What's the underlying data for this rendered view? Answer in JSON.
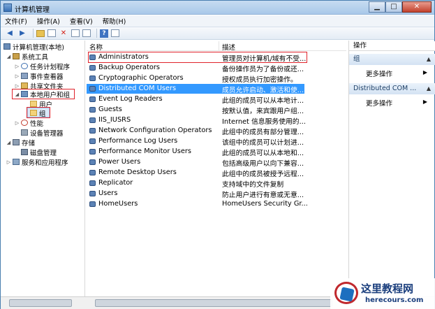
{
  "window": {
    "title": "计算机管理",
    "min_label": "▁",
    "max_label": "□",
    "close_label": "✕"
  },
  "menu": [
    "文件(F)",
    "操作(A)",
    "查看(V)",
    "帮助(H)"
  ],
  "toolbar_icons": [
    "back-arrow-icon",
    "forward-arrow-icon",
    "up-folder-icon",
    "show-tree-icon",
    "delete-icon",
    "properties-icon",
    "export-icon",
    "help-icon",
    "view-icon"
  ],
  "tree": {
    "root": "计算机管理(本地)",
    "system_tools": "系统工具",
    "task_scheduler": "任务计划程序",
    "event_viewer": "事件查看器",
    "shared_folders": "共享文件夹",
    "local_users_groups": "本地用户和组",
    "users": "用户",
    "groups": "组",
    "performance": "性能",
    "device_manager": "设备管理器",
    "storage": "存储",
    "disk_management": "磁盘管理",
    "services_apps": "服务和应用程序"
  },
  "list": {
    "col_name": "名称",
    "col_desc": "描述",
    "rows": [
      {
        "name": "Administrators",
        "desc": "管理员对计算机/域有不受..."
      },
      {
        "name": "Backup Operators",
        "desc": "备份操作员为了备份或还..."
      },
      {
        "name": "Cryptographic Operators",
        "desc": "授权成员执行加密操作。"
      },
      {
        "name": "Distributed COM Users",
        "desc": "成员允许启动、激活和使..."
      },
      {
        "name": "Event Log Readers",
        "desc": "此组的成员可以从本地计..."
      },
      {
        "name": "Guests",
        "desc": "按默认值，来宾跟用户组..."
      },
      {
        "name": "IIS_IUSRS",
        "desc": "Internet 信息服务使用的..."
      },
      {
        "name": "Network Configuration Operators",
        "desc": "此组中的成员有部分管理..."
      },
      {
        "name": "Performance Log Users",
        "desc": "该组中的成员可以计划进..."
      },
      {
        "name": "Performance Monitor Users",
        "desc": "此组的成员可以从本地和..."
      },
      {
        "name": "Power Users",
        "desc": "包括高级用户以向下兼容..."
      },
      {
        "name": "Remote Desktop Users",
        "desc": "此组中的成员被授予远程..."
      },
      {
        "name": "Replicator",
        "desc": "支持域中的文件复制"
      },
      {
        "name": "Users",
        "desc": "防止用户进行有意或无意..."
      },
      {
        "name": "HomeUsers",
        "desc": "HomeUsers Security Gr..."
      }
    ]
  },
  "actions": {
    "header": "操作",
    "section1": "组",
    "more1": "更多操作",
    "section2": "Distributed COM ...",
    "more2": "更多操作"
  },
  "watermark": {
    "title": "这里教程网",
    "url": "herecours.com"
  },
  "colors": {
    "selection": "#3399ff",
    "highlight_box": "#e0232b",
    "accent": "#1a3e7d"
  }
}
